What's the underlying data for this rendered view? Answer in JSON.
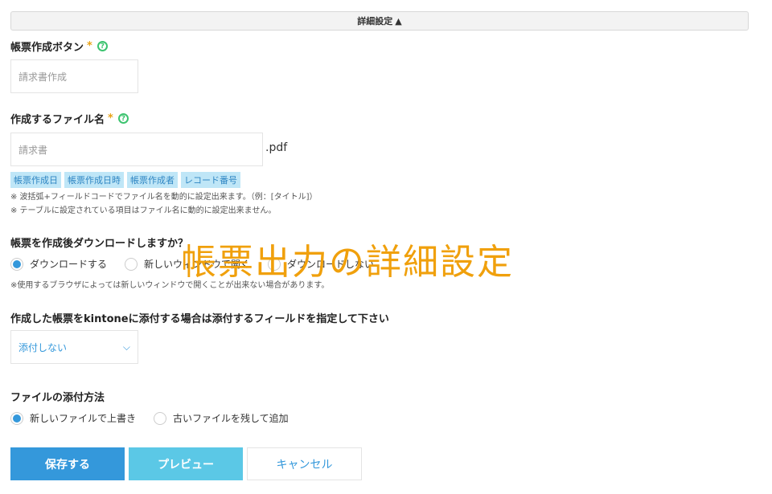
{
  "advanced_toggle": {
    "label": "詳細設定",
    "arrow": "▲"
  },
  "form_button": {
    "label": "帳票作成ボタン",
    "required_mark": "*",
    "help": "?",
    "placeholder": "請求書作成"
  },
  "file_name": {
    "label": "作成するファイル名",
    "required_mark": "*",
    "help": "?",
    "placeholder": "請求書",
    "suffix": ".pdf",
    "tags": [
      "帳票作成日",
      "帳票作成日時",
      "帳票作成者",
      "レコード番号"
    ],
    "notes": [
      "※ 波括弧+フィールドコードでファイル名を動的に設定出来ます。（例：[タイトル]）",
      "※ テーブルに設定されている項目はファイル名に動的に設定出来ません。"
    ]
  },
  "download": {
    "label": "帳票を作成後ダウンロードしますか？",
    "options": [
      "ダウンロードする",
      "新しいウィンドウで開く",
      "ダウンロードしない"
    ],
    "selected": 0,
    "note": "※使用するブラウザによっては新しいウィンドウで開くことが出来ない場合があります。"
  },
  "attach_field": {
    "label": "作成した帳票をkintoneに添付する場合は添付するフィールドを指定して下さい",
    "selected_value": "添付しない"
  },
  "attach_method": {
    "label": "ファイルの添付方法",
    "options": [
      "新しいファイルで上書き",
      "古いファイルを残して追加"
    ],
    "selected": 0
  },
  "actions": {
    "save": "保存する",
    "preview": "プレビュー",
    "cancel": "キャンセル"
  },
  "overlay_caption": "帳票出力の詳細設定",
  "colors": {
    "accent": "#3498db",
    "preview": "#5bc8e6",
    "required": "#e8a317",
    "help": "#3cc36f",
    "caption": "#f0a00c"
  }
}
